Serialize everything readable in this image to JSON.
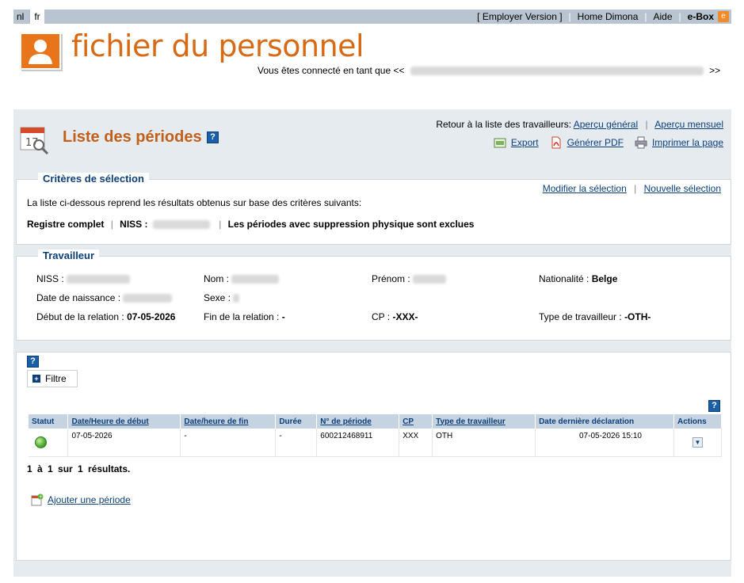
{
  "topbar": {
    "lang_nl": "nl",
    "lang_fr": "fr",
    "employer_version": "[ Employer Version ]",
    "home": "Home Dimona",
    "aide": "Aide",
    "ebox": "e-Box",
    "ebox_icon": "e"
  },
  "banner": {
    "title": "fichier du personnel",
    "connected_prefix": "Vous êtes connecté en tant que <<",
    "connected_suffix": ">>"
  },
  "page": {
    "title": "Liste des périodes",
    "help": "?",
    "retour_prefix": "Retour à la liste des travailleurs:",
    "apercu_general": "Aperçu général",
    "apercu_mensuel": "Aperçu mensuel",
    "export": "Export",
    "pdf": "Générer PDF",
    "print": "Imprimer la page"
  },
  "criteria": {
    "legend": "Critères de sélection",
    "modify": "Modifier la sélection",
    "new": "Nouvelle sélection",
    "intro": "La liste ci-dessous reprend les résultats obtenus sur base des critères suivants:",
    "registre": "Registre complet",
    "niss_label": "NISS :",
    "exclusion": "Les périodes avec suppression physique sont exclues"
  },
  "worker": {
    "legend": "Travailleur",
    "niss_label": "NISS :",
    "nom_label": "Nom :",
    "prenom_label": "Prénom :",
    "nationalite_label": "Nationalité :",
    "nationalite_value": "Belge",
    "naissance_label": "Date de naissance :",
    "sexe_label": "Sexe :",
    "debut_label": "Début de la relation :",
    "debut_value": "07-05-2026",
    "fin_label": "Fin de la relation :",
    "fin_value": "-",
    "cp_label": "CP :",
    "cp_value": "-XXX-",
    "type_label": "Type de travailleur :",
    "type_value": "-OTH-"
  },
  "list": {
    "help": "?",
    "filter": "Filtre",
    "columns": {
      "statut": "Statut",
      "debut": "Date/Heure de début",
      "fin": "Date/heure de fin",
      "duree": "Durée",
      "numero": "N° de période",
      "cp": "CP",
      "type": "Type de travailleur",
      "derniere": "Date dernière déclaration",
      "actions": "Actions"
    },
    "rows": [
      {
        "debut": "07-05-2026",
        "fin": "-",
        "duree": "-",
        "numero": "600212468911",
        "cp": "XXX",
        "type": "OTH",
        "derniere": "07-05-2026 15:10"
      }
    ],
    "result": "1 à 1 sur 1 résultats.",
    "add": "Ajouter une période"
  },
  "colors": {
    "accent_orange": "#d86a16",
    "link_blue": "#0b3f7a",
    "header_blue": "#c6d3e0",
    "status_green": "#4aa832"
  }
}
